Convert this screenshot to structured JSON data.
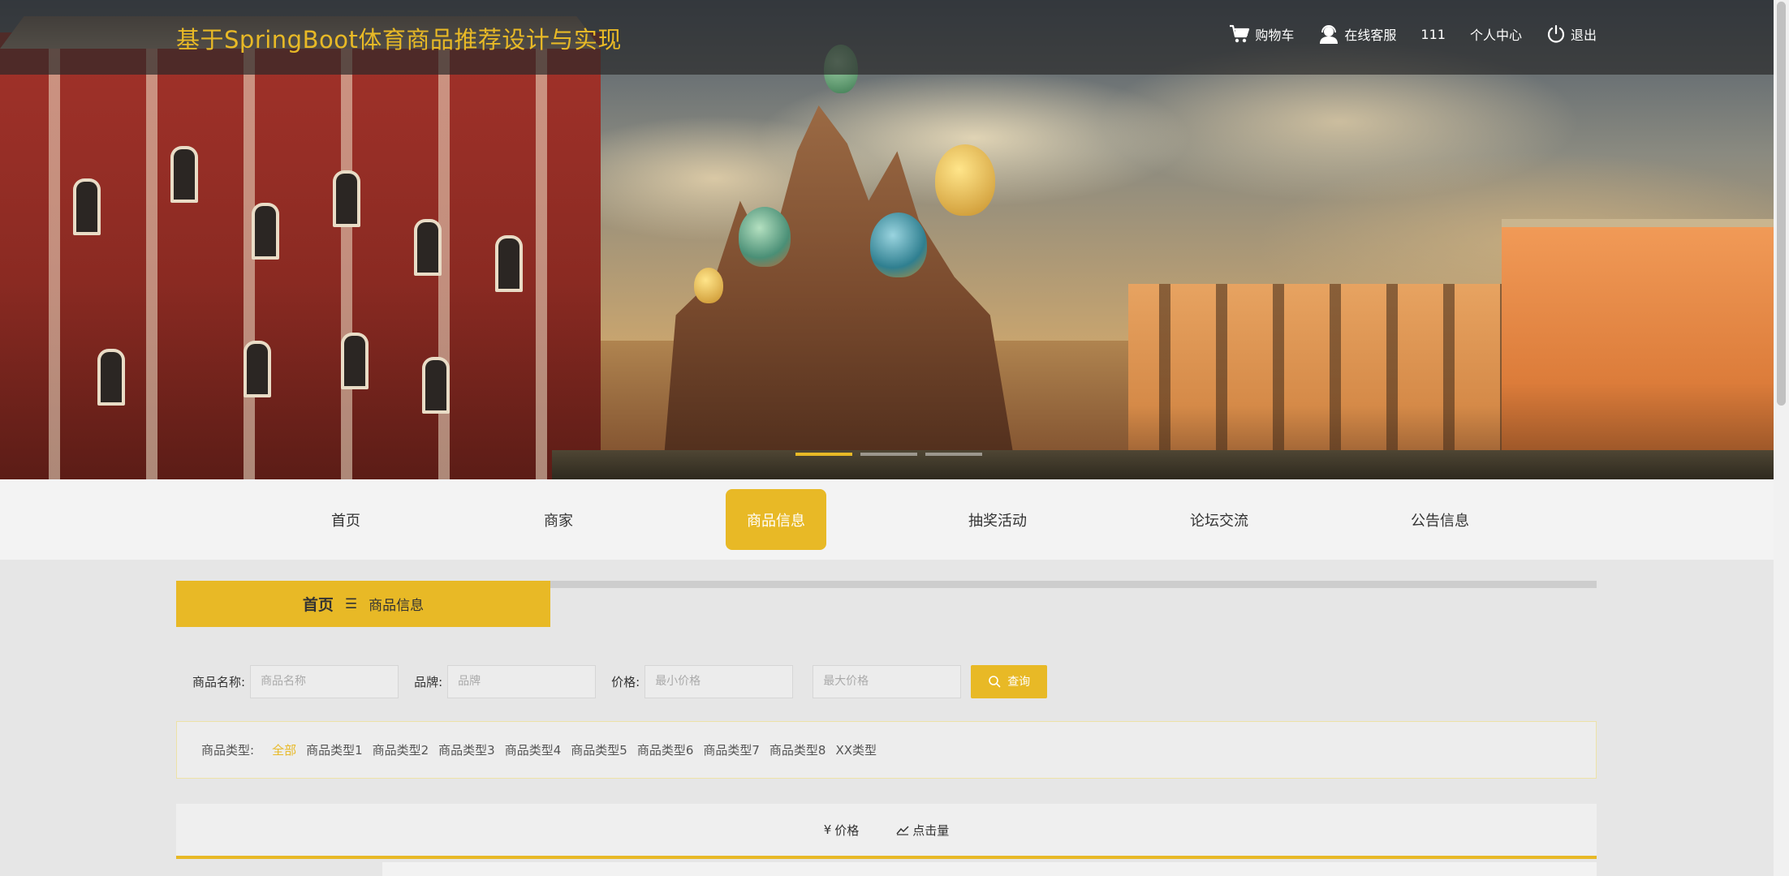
{
  "header": {
    "site_title": "基于SpringBoot体育商品推荐设计与实现",
    "links": {
      "cart": "购物车",
      "service": "在线客服",
      "username": "111",
      "profile": "个人中心",
      "logout": "退出"
    }
  },
  "nav": {
    "items": [
      {
        "label": "首页"
      },
      {
        "label": "商家"
      },
      {
        "label": "商品信息"
      },
      {
        "label": "抽奖活动"
      },
      {
        "label": "论坛交流"
      },
      {
        "label": "公告信息"
      }
    ],
    "active_index": 2
  },
  "breadcrumb": {
    "home": "首页",
    "separator": "☰",
    "current": "商品信息"
  },
  "search": {
    "name_label": "商品名称:",
    "name_placeholder": "商品名称",
    "brand_label": "品牌:",
    "brand_placeholder": "品牌",
    "price_label": "价格:",
    "min_price_placeholder": "最小价格",
    "max_price_placeholder": "最大价格",
    "button_label": "查询"
  },
  "categories": {
    "label": "商品类型:",
    "items": [
      "全部",
      "商品类型1",
      "商品类型2",
      "商品类型3",
      "商品类型4",
      "商品类型5",
      "商品类型6",
      "商品类型7",
      "商品类型8",
      "XX类型"
    ],
    "active_index": 0
  },
  "sort": {
    "price_label": "价格",
    "price_symbol": "¥",
    "clicks_label": "点击量"
  },
  "colors": {
    "accent": "#e8b926",
    "topbar": "#282828"
  }
}
